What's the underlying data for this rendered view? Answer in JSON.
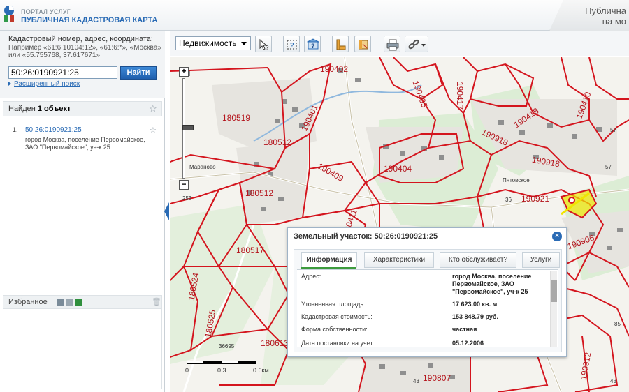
{
  "header": {
    "portal_small": "ПОРТАЛ УСЛУГ",
    "portal_title": "ПУБЛИЧНАЯ КАДАСТРОВАЯ КАРТА",
    "right_title_line1": "Публична",
    "right_title_line2": "на мо"
  },
  "search": {
    "hint_title": "Кадастровый номер, адрес, координата:",
    "hint_examples": "Например «61:6:10104:12», «61:6:*», «Москва» или «55.755768, 37.617671»",
    "value": "50:26:0190921:25",
    "button_label": "Найти",
    "advanced_label": "Расширенный поиск"
  },
  "results": {
    "found_prefix": "Найден ",
    "found_count": "1 объект",
    "items": [
      {
        "num": "1.",
        "link": "50:26:0190921:25",
        "address": "город Москва, поселение Первомайское, ЗАО \"Первомайское\", уч-к 25"
      }
    ]
  },
  "favorites": {
    "label": "Избранное"
  },
  "toolbar": {
    "layer_select": "Недвижимость"
  },
  "map": {
    "zoom_level": "253",
    "scale": [
      "0",
      "0.3",
      "0.6км"
    ],
    "plot_labels": [
      "190402",
      "190417",
      "190405",
      "190410",
      "180519",
      "190401",
      "190418",
      "190918",
      "190918",
      "180512",
      "190409",
      "190404",
      "180512",
      "190411",
      "190921",
      "180517",
      "180524",
      "180525",
      "180613",
      "190906",
      "190807",
      "190912"
    ],
    "small_labels": [
      "57",
      "57",
      "36",
      "36695",
      "43",
      "85",
      "43"
    ],
    "place_labels": [
      "Пятовское",
      "Мараново"
    ]
  },
  "popup": {
    "title": "Земельный участок: 50:26:0190921:25",
    "tabs": [
      "Информация",
      "Характеристики",
      "Кто обслуживает?",
      "Услуги"
    ],
    "rows": [
      {
        "label": "Адрес:",
        "value": "город Москва, поселение Первомайское, ЗАО \"Первомайское\", уч-к 25"
      },
      {
        "label": "Уточненная площадь:",
        "value": "17 623.00 кв. м"
      },
      {
        "label": "Кадастровая стоимость:",
        "value": "153 848.79 руб."
      },
      {
        "label": "Форма собственности:",
        "value": "частная"
      },
      {
        "label": "Дата постановки на учет:",
        "value": "05.12.2006"
      }
    ]
  },
  "colors": {
    "brand_blue": "#2a6bb5",
    "parcel_red": "#d4151e",
    "selected_yellow": "#f1e500",
    "tab_green": "#3d9b3d"
  }
}
